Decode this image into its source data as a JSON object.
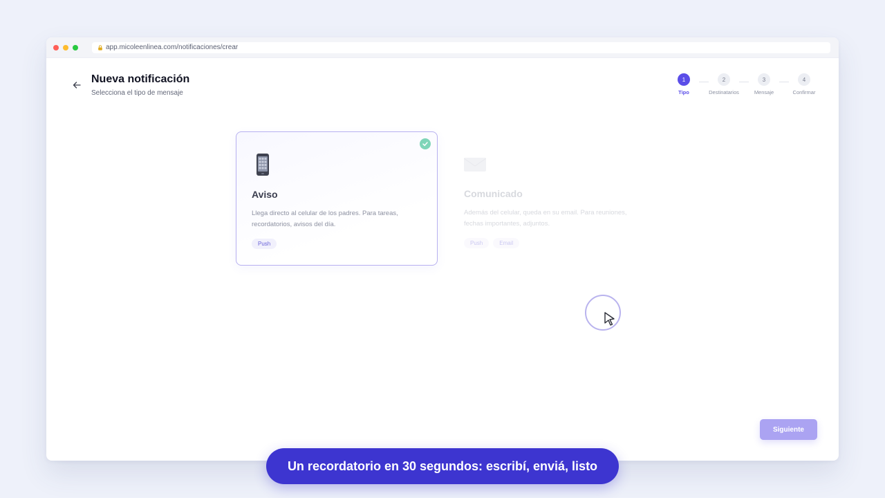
{
  "browser": {
    "url": "app.micoleenlinea.com/notificaciones/crear"
  },
  "header": {
    "title": "Nueva notificación",
    "subtitle": "Selecciona el tipo de mensaje"
  },
  "stepper": {
    "steps": [
      {
        "number": "1",
        "label": "Tipo",
        "active": true
      },
      {
        "number": "2",
        "label": "Destinatarios",
        "active": false
      },
      {
        "number": "3",
        "label": "Mensaje",
        "active": false
      },
      {
        "number": "4",
        "label": "Confirmar",
        "active": false
      }
    ]
  },
  "cards": [
    {
      "icon": "mobile-phone-icon",
      "title": "Aviso",
      "description": "Llega directo al celular de los padres. Para tareas, recordatorios, avisos del día.",
      "chips": [
        "Push"
      ],
      "selected": true
    },
    {
      "icon": "envelope-icon",
      "title": "Comunicado",
      "description": "Además del celular, queda en su email. Para reuniones, fechas importantes, adjuntos.",
      "chips": [
        "Push",
        "Email"
      ],
      "selected": false
    }
  ],
  "footer": {
    "next_label": "Siguiente"
  },
  "caption": {
    "text": "Un recordatorio en 30 segundos: escribí, enviá, listo"
  },
  "colors": {
    "accent": "#5b4ee8",
    "caption_bg": "#3d35d0",
    "check": "#7fd5b8",
    "button": "#aba3f2"
  }
}
